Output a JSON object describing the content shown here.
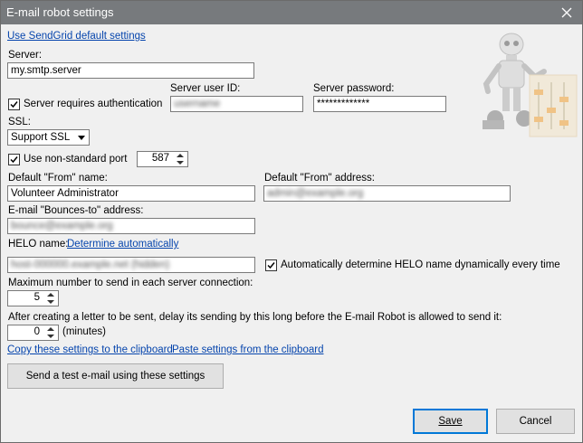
{
  "window": {
    "title": "E-mail robot settings"
  },
  "links": {
    "sendgrid": "Use SendGrid default settings",
    "determine": "Determine automatically",
    "copy": "Copy these settings to the clipboard",
    "paste": "Paste settings from the clipboard"
  },
  "server": {
    "label": "Server:",
    "value": "my.smtp.server"
  },
  "auth": {
    "checkbox_label": "Server requires authentication",
    "checked": true
  },
  "user_id": {
    "label": "Server user ID:",
    "value": "username"
  },
  "password": {
    "label": "Server password:",
    "value": "*************"
  },
  "ssl": {
    "label": "SSL:",
    "selected": "Support SSL"
  },
  "port": {
    "checkbox_label": "Use non-standard port",
    "checked": true,
    "value": "587"
  },
  "from_name": {
    "label": "Default \"From\" name:",
    "value": "Volunteer Administrator"
  },
  "from_address": {
    "label": "Default \"From\" address:",
    "value": "admin@example.org"
  },
  "bounces": {
    "label": "E-mail \"Bounces-to\" address:",
    "value": "bounce@example.org"
  },
  "helo": {
    "label": "HELO name:",
    "value": "host-000000.example.net (hidden)",
    "auto_label": "Automatically determine HELO name dynamically every time",
    "auto_checked": true
  },
  "max_send": {
    "label": "Maximum number to send in each server connection:",
    "value": "5"
  },
  "delay": {
    "label": "After creating a letter to be sent, delay its sending by this long before the E-mail Robot is allowed to send it:",
    "value": "0",
    "unit": "(minutes)"
  },
  "buttons": {
    "test": "Send a test e-mail using these settings",
    "save": "Save",
    "cancel": "Cancel"
  },
  "icons": {
    "close": "close-icon",
    "robot": "robot-illustration",
    "check": "checkmark-icon",
    "dropdown": "chevron-down-icon"
  },
  "colors": {
    "titlebar": "#777a7d",
    "link": "#0645ad",
    "accent": "#0078d7",
    "robot_bar": "#f0a030"
  }
}
